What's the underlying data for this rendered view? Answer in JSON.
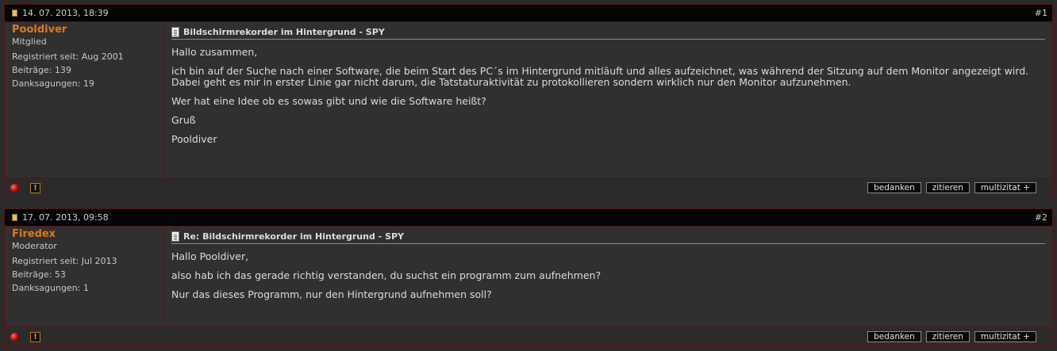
{
  "posts": [
    {
      "date": "14. 07. 2013, 18:39",
      "number": "#1",
      "username": "Pooldiver",
      "usertitle": "Mitglied",
      "registered": "Registriert seit: Aug 2001",
      "posts_count": "Beiträge: 139",
      "thanks": "Danksagungen: 19",
      "title": "Bildschirmrekorder im Hintergrund - SPY",
      "message": [
        "Hallo zusammen,",
        "ich bin auf der Suche nach einer Software, die beim Start des PC´s im Hintergrund mitläuft und alles aufzeichnet, was während der Sitzung auf dem Monitor angezeigt wird. Dabei geht es mir in erster Linie gar nicht darum, die Tatstaturaktivität zu protokollieren sondern wirklich nur den Monitor aufzunehmen.",
        "Wer hat eine Idee ob es sowas gibt und wie die Software heißt?",
        "Gruß",
        "Pooldiver"
      ]
    },
    {
      "date": "17. 07. 2013, 09:58",
      "number": "#2",
      "username": "Firedex",
      "usertitle": "Moderator",
      "registered": "Registriert seit: Jul 2013",
      "posts_count": "Beiträge: 53",
      "thanks": "Danksagungen: 1",
      "title": "Re: Bildschirmrekorder im Hintergrund - SPY",
      "message": [
        "Hallo Pooldiver,",
        "also hab ich das gerade richtig verstanden, du suchst ein programm zum aufnehmen?",
        "Nur das dieses Programm, nur den Hintergrund aufnehmen soll?"
      ]
    }
  ],
  "buttons": {
    "thank": "bedanken",
    "quote": "zitieren",
    "multiquote": "multizitat +"
  },
  "icons": {
    "report": "!",
    "post_icon": "document-icon",
    "status": "offline-status-icon"
  },
  "colors": {
    "username": "#e07a17",
    "border": "#5a1414",
    "header_bg": "#050505"
  }
}
